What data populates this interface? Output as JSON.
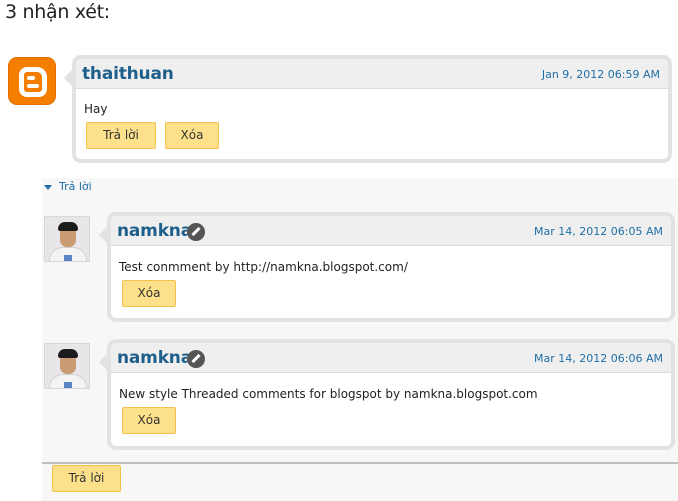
{
  "heading": "3 nhận xét:",
  "comments": [
    {
      "author": "thaithuan",
      "date": "Jan 9, 2012 06:59 AM",
      "text": "Hay",
      "reply_label": "Trả lời",
      "delete_label": "Xóa"
    }
  ],
  "thread": {
    "toggle_label": "Trả lời",
    "replies": [
      {
        "author": "namkna",
        "date": "Mar 14, 2012 06:05 AM",
        "text": "Test conmment by http://namkna.blogspot.com/",
        "delete_label": "Xóa"
      },
      {
        "author": "namkna",
        "date": "Mar 14, 2012 06:06 AM",
        "text": "New style Threaded comments for blogspot by namkna.blogspot.com",
        "delete_label": "Xóa"
      }
    ],
    "reply_button_label": "Trả lời"
  },
  "icons": {
    "blogger": "blogger-logo-icon",
    "edit": "pencil-icon",
    "toggle": "triangle-down-icon"
  },
  "colors": {
    "author": "#1f5f8b",
    "link": "#1f6fa6",
    "button": "#fde18a",
    "bubble_border": "#e2e2e2"
  }
}
